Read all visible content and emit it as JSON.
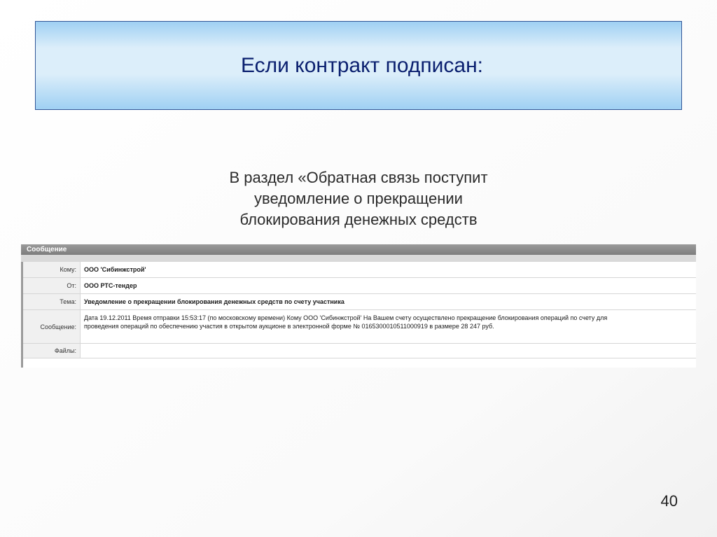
{
  "slide": {
    "title": "Если контракт подписан:",
    "subtitle_lines": [
      "В раздел «Обратная связь поступит",
      "уведомление о прекращении",
      "блокирования денежных средств"
    ],
    "page_number": "40"
  },
  "message": {
    "header": "Сообщение",
    "fields": {
      "to": {
        "label": "Кому:",
        "value": "ООО 'Сибинжстрой'"
      },
      "from": {
        "label": "От:",
        "value": "ООО РТС-тендер"
      },
      "subject": {
        "label": "Тема:",
        "value": "Уведомление о прекращении блокирования денежных средств по счету участника"
      },
      "body": {
        "label": "Сообщение:",
        "lines": [
          "Дата 19.12.2011 Время отправки 15:53:17 (по московскому времени) Кому ООО 'Сибинжстрой' На Вашем счету осуществлено прекращение блокирования операций по счету для",
          "проведения операций по обеспечению участия в открытом аукционе в электронной форме № 0165300010511000919 в размере 28 247 руб."
        ]
      },
      "files": {
        "label": "Файлы:",
        "value": ""
      }
    }
  },
  "colors": {
    "title_text": "#0a1f6f",
    "title_border": "#2f5597",
    "header_bg": "#8a8a8a"
  }
}
